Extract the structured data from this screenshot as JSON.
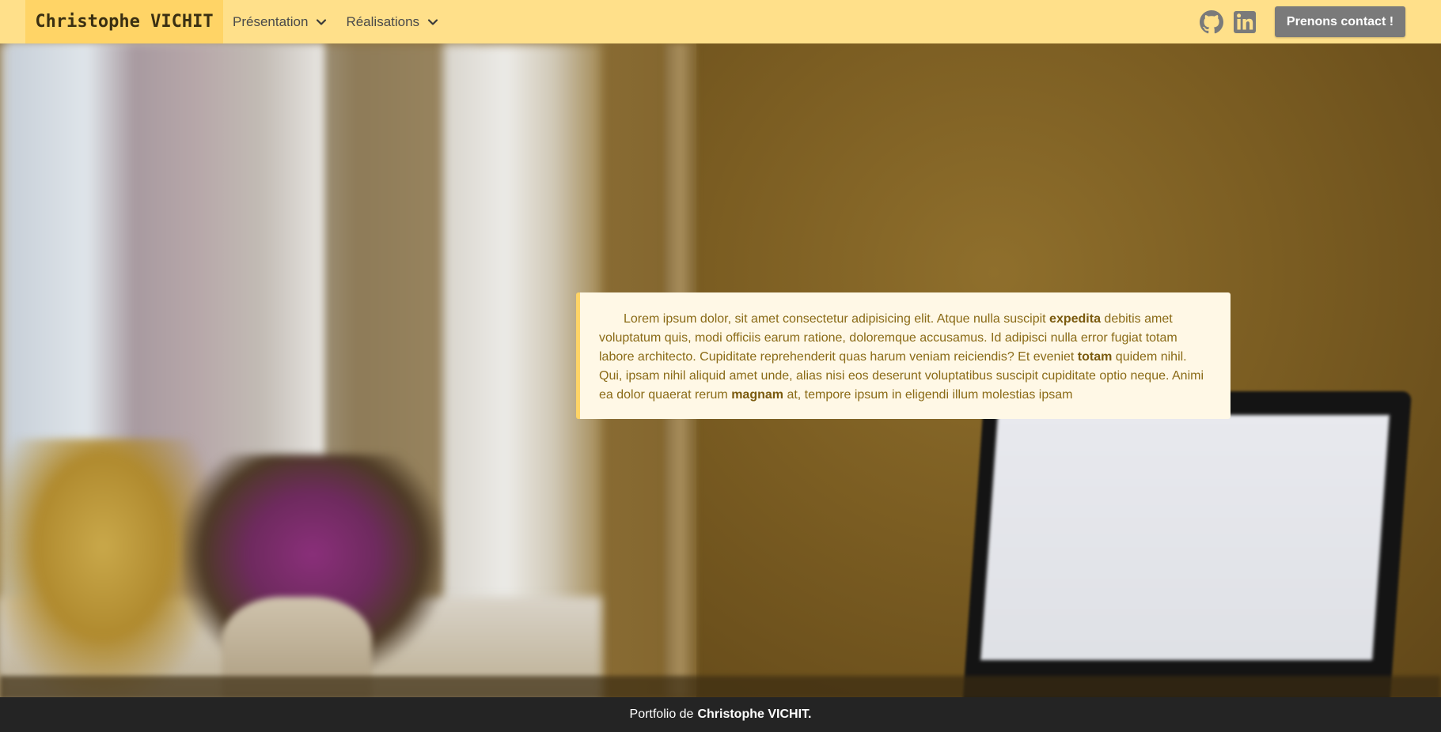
{
  "navbar": {
    "brand": "Christophe VICHIT",
    "items": [
      {
        "label": "Présentation"
      },
      {
        "label": "Réalisations"
      }
    ],
    "social": [
      "github-icon",
      "linkedin-icon"
    ],
    "contact_label": "Prenons contact !"
  },
  "card": {
    "segments": [
      {
        "text": "Lorem ipsum dolor, sit amet consectetur adipisicing elit. Atque nulla suscipit "
      },
      {
        "bold": "expedita"
      },
      {
        "text": " debitis amet voluptatum quis, modi officiis earum ratione, doloremque accusamus. Id adipisci nulla error fugiat totam labore architecto. Cupiditate reprehenderit quas harum veniam reiciendis? Et eveniet "
      },
      {
        "bold": "totam"
      },
      {
        "text": " quidem nihil. Qui, ipsam nihil aliquid amet unde, alias nisi eos deserunt voluptatibus suscipit cupiditate optio neque. Animi ea dolor quaerat rerum "
      },
      {
        "bold": "magnam"
      },
      {
        "text": " at, tempore ipsum in eligendi illum molestias ipsam"
      }
    ]
  },
  "footer": {
    "prefix": "Portfolio de",
    "name": "Christophe VICHIT."
  },
  "colors": {
    "navbar_bg": "#ffe08a",
    "brand_bg": "#ffd466",
    "contact_btn_bg": "#7a7a7a",
    "card_bg": "#fff8e6",
    "card_text": "#8a6a16",
    "footer_bg": "#242424"
  }
}
